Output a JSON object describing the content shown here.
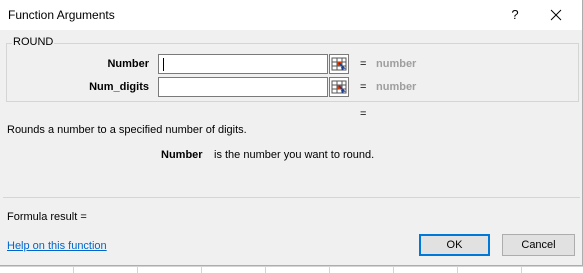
{
  "window": {
    "title": "Function Arguments",
    "help_glyph": "?",
    "close_icon": "close-icon"
  },
  "group": {
    "function_name": "ROUND"
  },
  "arguments": [
    {
      "label": "Number",
      "value": "",
      "equals": "=",
      "result": "number"
    },
    {
      "label": "Num_digits",
      "value": "",
      "equals": "=",
      "result": "number"
    }
  ],
  "overall_equals": "=",
  "description": "Rounds a number to a specified number of digits.",
  "arg_help": {
    "name": "Number",
    "text": "is the number you want to round."
  },
  "formula_result": "Formula result =",
  "help_link": "Help on this function",
  "buttons": {
    "ok": "OK",
    "cancel": "Cancel"
  },
  "colors": {
    "link": "#0066cc",
    "default_button_border": "#0078d7",
    "result_text": "#9e9e9e"
  }
}
